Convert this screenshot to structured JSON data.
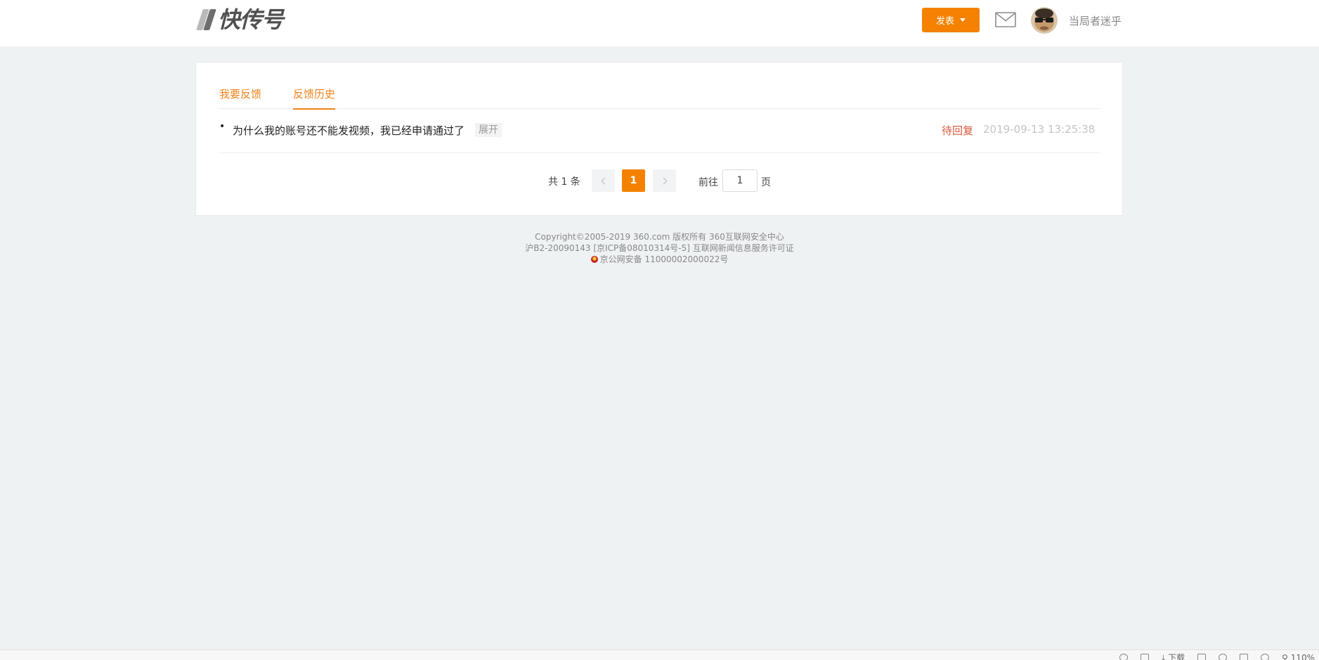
{
  "header": {
    "logo_text": "快传号",
    "publish_label": "发表",
    "username": "当局者迷乎"
  },
  "tabs": [
    {
      "label": "我要反馈",
      "active": false
    },
    {
      "label": "反馈历史",
      "active": true
    }
  ],
  "feedback_list": [
    {
      "bullet": "•",
      "title": "为什么我的账号还不能发视频，我已经申请通过了",
      "expand_label": "展开",
      "status": "待回复",
      "time": "2019-09-13 13:25:38"
    }
  ],
  "pager": {
    "total_text": "共 1 条",
    "current_page": "1",
    "goto_label": "前往",
    "goto_value": "1",
    "goto_suffix": "页"
  },
  "footer": {
    "line1": "Copyright©2005-2019 360.com 版权所有 360互联网安全中心",
    "line2": "沪B2-20090143 [京ICP备08010314号-5] 互联网新闻信息服务许可证",
    "line3": "京公网安备 11000002000022号"
  },
  "browser_status": {
    "download_label": "下载",
    "zoom": "110%"
  },
  "colors": {
    "accent": "#f48200",
    "tab_text": "#f0821a",
    "status_pending": "#d9583b",
    "page_bg": "#eff2f3"
  },
  "icons": [
    "mail-icon",
    "caret-down-icon",
    "chevron-left-icon",
    "chevron-right-icon",
    "police-emblem-icon"
  ]
}
